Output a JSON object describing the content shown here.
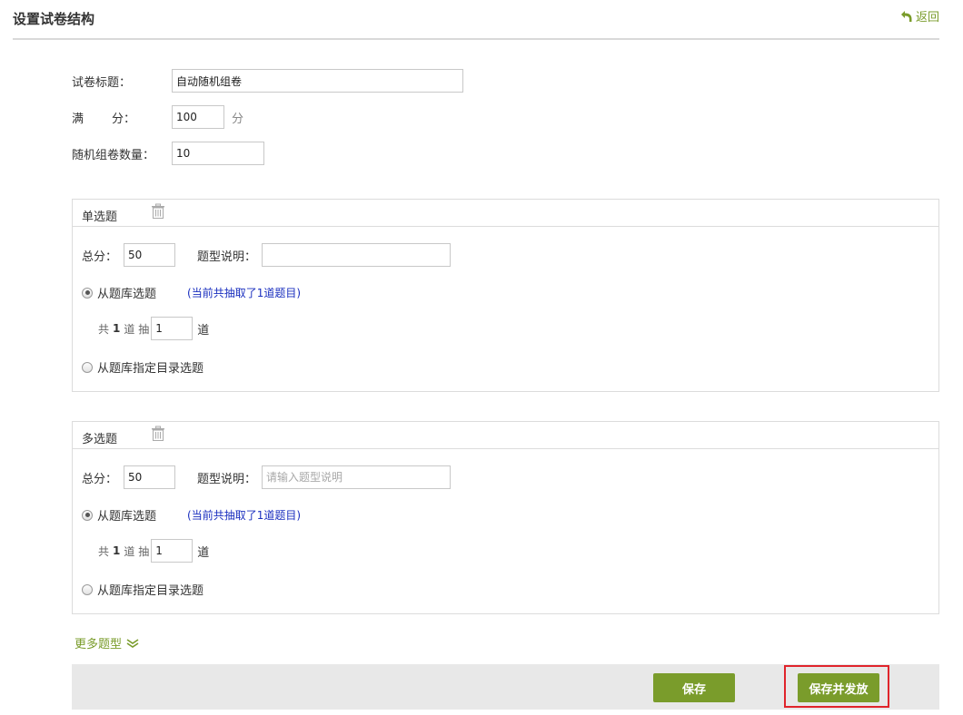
{
  "header": {
    "title": "设置试卷结构",
    "back_label": "返回"
  },
  "form": {
    "title_label": "试卷标题：",
    "title_value": "自动随机组卷",
    "score_label_a": "满",
    "score_label_b": "分：",
    "score_value": "100",
    "score_unit": "分",
    "count_label": "随机组卷数量：",
    "count_value": "10"
  },
  "sections": [
    {
      "title": "单选题",
      "score_label": "总分：",
      "score_value": "50",
      "desc_label": "题型说明：",
      "desc_value": "",
      "desc_placeholder": "",
      "option_bank": "从题库选题",
      "hint": "(当前共抽取了1道题目)",
      "draw_prefix": "共",
      "draw_total": "1",
      "draw_mid": "道 抽",
      "draw_value": "1",
      "draw_suffix": "道",
      "option_dir": "从题库指定目录选题",
      "selected": "bank"
    },
    {
      "title": "多选题",
      "score_label": "总分：",
      "score_value": "50",
      "desc_label": "题型说明：",
      "desc_value": "",
      "desc_placeholder": "请输入题型说明",
      "option_bank": "从题库选题",
      "hint": "(当前共抽取了1道题目)",
      "draw_prefix": "共",
      "draw_total": "1",
      "draw_mid": "道 抽",
      "draw_value": "1",
      "draw_suffix": "道",
      "option_dir": "从题库指定目录选题",
      "selected": "bank"
    }
  ],
  "more_types_label": "更多题型",
  "footer": {
    "save_label": "保存",
    "save_publish_label": "保存并发放"
  },
  "colors": {
    "accent": "#7a9c2b",
    "hint": "#1a2fbf",
    "highlight": "#e0242b"
  },
  "icons": [
    "undo-arrow-icon",
    "trash-icon",
    "double-chevron-down-icon"
  ]
}
